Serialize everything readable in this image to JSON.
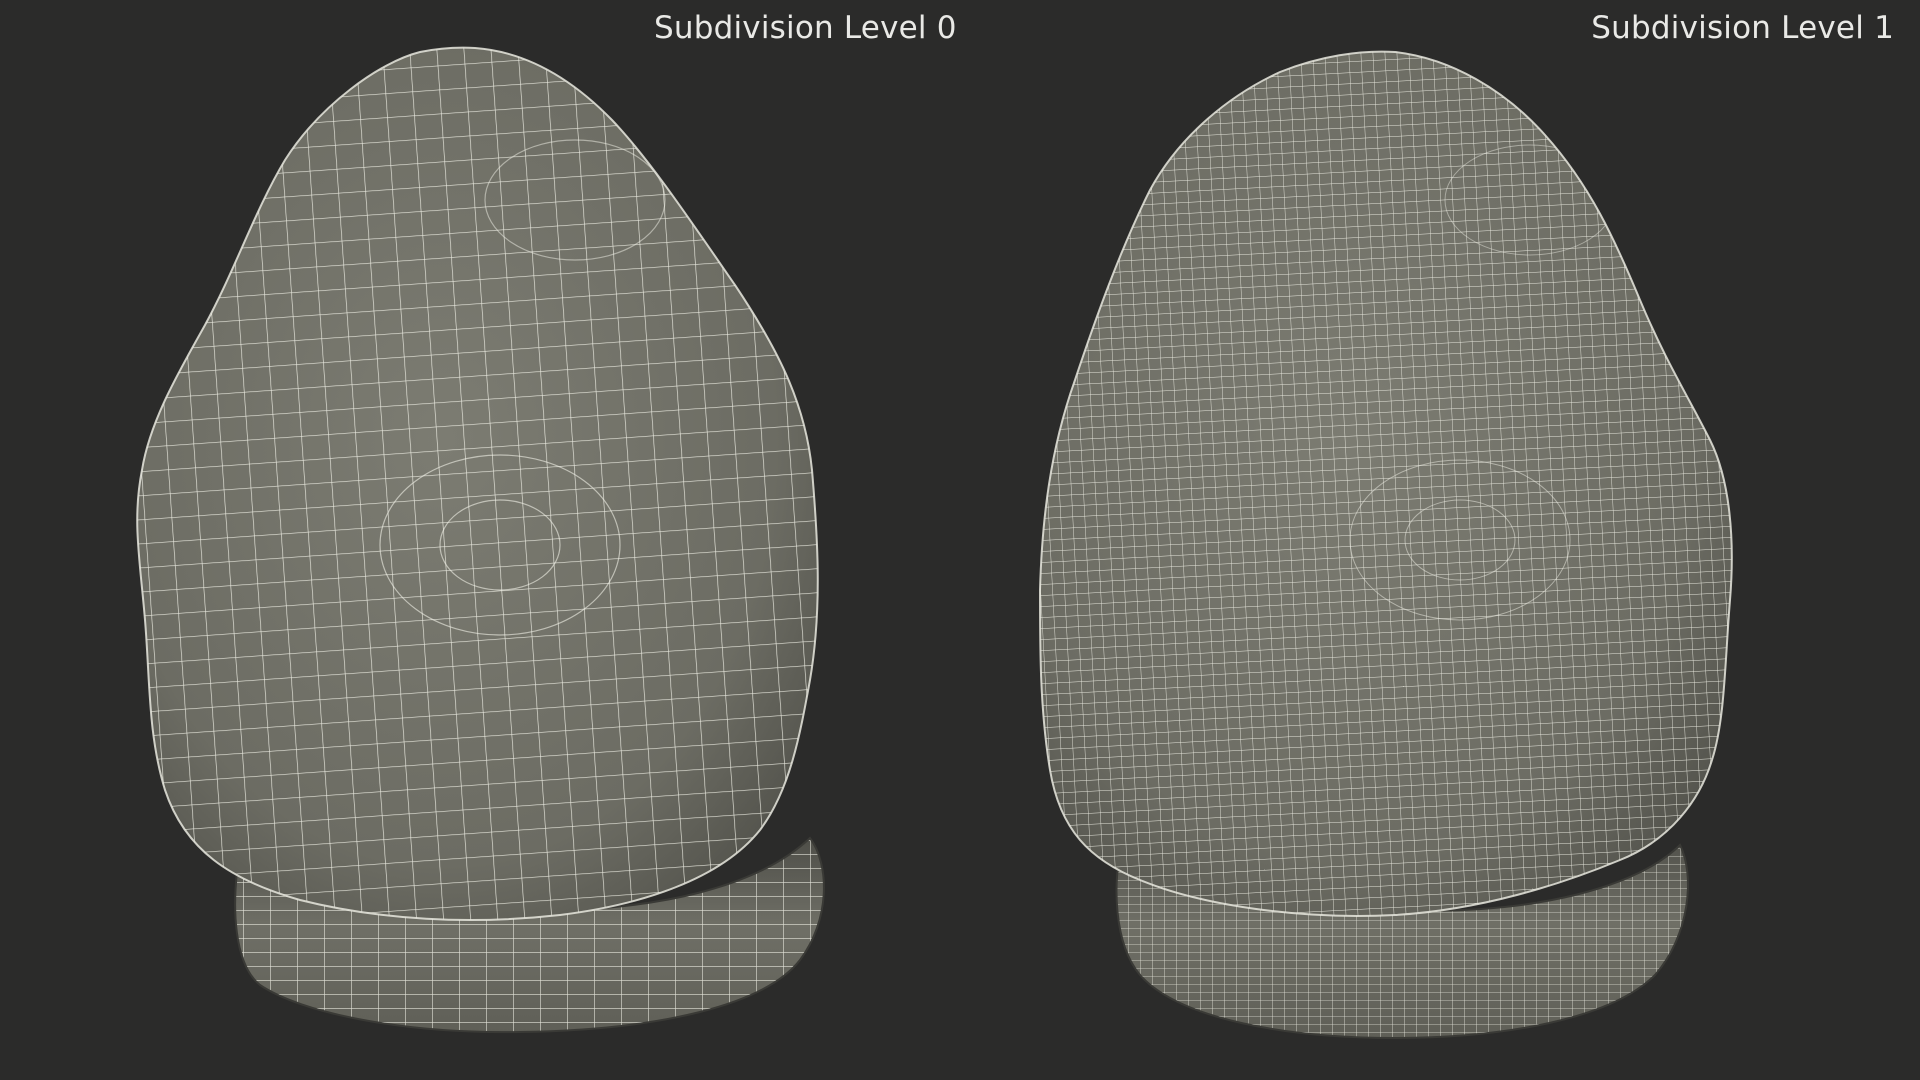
{
  "panels": [
    {
      "label": "Subdivision Level 0",
      "wire_density": "coarse"
    },
    {
      "label": "Subdivision Level 1",
      "wire_density": "fine"
    }
  ],
  "colors": {
    "background": "#2b2b2a",
    "surface": "#74746a",
    "surface_shadow": "#5a5a52",
    "wireframe": "#f2f2e8",
    "label_text": "#e9e9e6"
  }
}
